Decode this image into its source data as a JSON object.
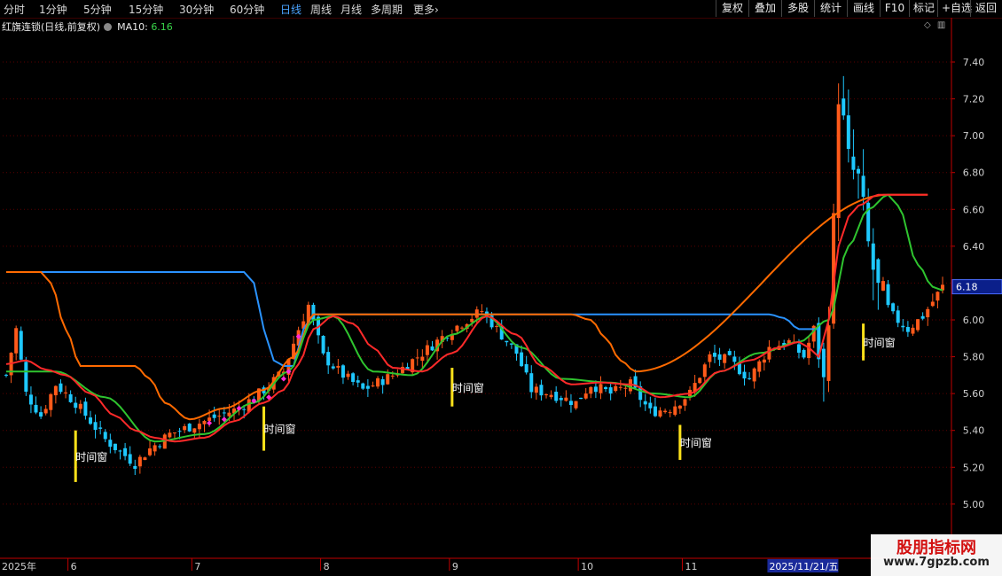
{
  "toolbar": {
    "periods": [
      "分时",
      "1分钟",
      "5分钟",
      "15分钟",
      "30分钟",
      "60分钟",
      "日线",
      "周线",
      "月线",
      "多周期",
      "更多"
    ],
    "active_period": "日线",
    "more_arrow": "›",
    "buttons": [
      "复权",
      "叠加",
      "多股",
      "统计",
      "画线",
      "F10",
      "标记",
      "+自选",
      "返回"
    ]
  },
  "info": {
    "title": "红旗连锁(日线,前复权)",
    "ma_label": "MA10:",
    "ma_value": "6.16"
  },
  "icons": [
    "diamond-icon",
    "panel-icon"
  ],
  "price_tag": "6.18",
  "signal_label": "时间窗",
  "watermark": {
    "line1": "股朋指标网",
    "line2": "www.7gpzb.com"
  },
  "colors": {
    "up": "#ff5a1a",
    "down": "#1ec8ff",
    "red_line": "#ff2a2a",
    "blue_line": "#2a93ff",
    "orange_line": "#ff6a00",
    "green_line": "#2fc42f",
    "signal": "#ffe21a",
    "dot": "#ff2ad6",
    "axis": "#c00000"
  },
  "chart_data": {
    "type": "candlestick",
    "title": "红旗连锁(日线,前复权)",
    "y_ticks": [
      5.0,
      5.2,
      5.4,
      5.6,
      5.8,
      6.0,
      6.2,
      6.4,
      6.6,
      6.8,
      7.0,
      7.2,
      7.4
    ],
    "ylim": [
      4.88,
      7.57
    ],
    "x_labels": [
      {
        "label": "2025年",
        "index": 0
      },
      {
        "label": "6",
        "index": 13
      },
      {
        "label": "7",
        "index": 38
      },
      {
        "label": "8",
        "index": 64
      },
      {
        "label": "9",
        "index": 90
      },
      {
        "label": "10",
        "index": 116
      },
      {
        "label": "11",
        "index": 137
      },
      {
        "label": "2025/11/21/五",
        "index": 154
      }
    ],
    "num_candles": 190,
    "anchors": [
      {
        "i": 0,
        "p": 5.7
      },
      {
        "i": 2,
        "p": 5.95
      },
      {
        "i": 4,
        "p": 5.6
      },
      {
        "i": 7,
        "p": 5.48
      },
      {
        "i": 10,
        "p": 5.65
      },
      {
        "i": 14,
        "p": 5.55
      },
      {
        "i": 20,
        "p": 5.35
      },
      {
        "i": 26,
        "p": 5.22
      },
      {
        "i": 29,
        "p": 5.3
      },
      {
        "i": 33,
        "p": 5.38
      },
      {
        "i": 40,
        "p": 5.45
      },
      {
        "i": 47,
        "p": 5.52
      },
      {
        "i": 52,
        "p": 5.62
      },
      {
        "i": 56,
        "p": 5.72
      },
      {
        "i": 59,
        "p": 5.95
      },
      {
        "i": 61,
        "p": 6.08
      },
      {
        "i": 64,
        "p": 5.8
      },
      {
        "i": 68,
        "p": 5.7
      },
      {
        "i": 72,
        "p": 5.62
      },
      {
        "i": 78,
        "p": 5.7
      },
      {
        "i": 84,
        "p": 5.82
      },
      {
        "i": 90,
        "p": 5.95
      },
      {
        "i": 96,
        "p": 6.05
      },
      {
        "i": 99,
        "p": 5.95
      },
      {
        "i": 103,
        "p": 5.82
      },
      {
        "i": 106,
        "p": 5.62
      },
      {
        "i": 110,
        "p": 5.6
      },
      {
        "i": 115,
        "p": 5.55
      },
      {
        "i": 118,
        "p": 5.65
      },
      {
        "i": 122,
        "p": 5.6
      },
      {
        "i": 126,
        "p": 5.65
      },
      {
        "i": 130,
        "p": 5.5
      },
      {
        "i": 134,
        "p": 5.52
      },
      {
        "i": 138,
        "p": 5.6
      },
      {
        "i": 142,
        "p": 5.8
      },
      {
        "i": 146,
        "p": 5.78
      },
      {
        "i": 150,
        "p": 5.68
      },
      {
        "i": 154,
        "p": 5.85
      },
      {
        "i": 158,
        "p": 5.88
      },
      {
        "i": 161,
        "p": 5.8
      },
      {
        "i": 163,
        "p": 5.95
      },
      {
        "i": 165,
        "p": 5.65
      },
      {
        "i": 167,
        "p": 6.5
      },
      {
        "i": 168,
        "p": 7.25
      },
      {
        "i": 170,
        "p": 6.85
      },
      {
        "i": 172,
        "p": 6.75
      },
      {
        "i": 174,
        "p": 6.4
      },
      {
        "i": 176,
        "p": 6.15
      },
      {
        "i": 179,
        "p": 6.02
      },
      {
        "i": 182,
        "p": 5.95
      },
      {
        "i": 185,
        "p": 6.02
      },
      {
        "i": 189,
        "p": 6.18
      }
    ],
    "series": [
      {
        "name": "MA10",
        "points": [
          {
            "i": 0,
            "v": 5.72
          },
          {
            "i": 10,
            "v": 5.72
          },
          {
            "i": 20,
            "v": 5.58
          },
          {
            "i": 30,
            "v": 5.34
          },
          {
            "i": 40,
            "v": 5.38
          },
          {
            "i": 50,
            "v": 5.55
          },
          {
            "i": 57,
            "v": 5.72
          },
          {
            "i": 62,
            "v": 6.0
          },
          {
            "i": 66,
            "v": 6.02
          },
          {
            "i": 74,
            "v": 5.72
          },
          {
            "i": 82,
            "v": 5.7
          },
          {
            "i": 90,
            "v": 5.92
          },
          {
            "i": 97,
            "v": 6.02
          },
          {
            "i": 104,
            "v": 5.85
          },
          {
            "i": 112,
            "v": 5.68
          },
          {
            "i": 122,
            "v": 5.66
          },
          {
            "i": 131,
            "v": 5.6
          },
          {
            "i": 138,
            "v": 5.58
          },
          {
            "i": 144,
            "v": 5.72
          },
          {
            "i": 152,
            "v": 5.82
          },
          {
            "i": 160,
            "v": 5.88
          },
          {
            "i": 166,
            "v": 6.0
          },
          {
            "i": 170,
            "v": 6.4
          },
          {
            "i": 174,
            "v": 6.6
          },
          {
            "i": 178,
            "v": 6.68
          },
          {
            "i": 180,
            "v": 6.62
          },
          {
            "i": 184,
            "v": 6.3
          },
          {
            "i": 187,
            "v": 6.18
          },
          {
            "i": 189,
            "v": 6.16
          }
        ]
      },
      {
        "name": "upper",
        "points": [
          {
            "i": 0,
            "v": 6.26
          },
          {
            "i": 48,
            "v": 6.26
          },
          {
            "i": 50,
            "v": 6.2
          },
          {
            "i": 52,
            "v": 5.95
          },
          {
            "i": 54,
            "v": 5.78
          },
          {
            "i": 56,
            "v": 5.75
          },
          {
            "i": 58,
            "v": 5.75
          },
          {
            "i": 60,
            "v": 5.95
          },
          {
            "i": 62,
            "v": 6.03
          },
          {
            "i": 154,
            "v": 6.03
          },
          {
            "i": 157,
            "v": 6.01
          },
          {
            "i": 160,
            "v": 5.95
          },
          {
            "i": 164,
            "v": 5.95
          }
        ]
      },
      {
        "name": "lower",
        "points": [
          {
            "i": 0,
            "v": 6.26
          },
          {
            "i": 7,
            "v": 6.26
          },
          {
            "i": 9,
            "v": 6.2
          },
          {
            "i": 12,
            "v": 5.95
          },
          {
            "i": 15,
            "v": 5.75
          },
          {
            "i": 20,
            "v": 5.75
          },
          {
            "i": 26,
            "v": 5.75
          },
          {
            "i": 29,
            "v": 5.68
          },
          {
            "i": 32,
            "v": 5.55
          },
          {
            "i": 37,
            "v": 5.46
          },
          {
            "i": 44,
            "v": 5.52
          },
          {
            "i": 52,
            "v": 5.62
          },
          {
            "i": 58,
            "v": 5.8
          },
          {
            "i": 62,
            "v": 6.03
          },
          {
            "i": 114,
            "v": 6.03
          },
          {
            "i": 118,
            "v": 6.0
          },
          {
            "i": 121,
            "v": 5.9
          },
          {
            "i": 124,
            "v": 5.78
          },
          {
            "i": 127,
            "v": 5.72
          },
          {
            "i": 178,
            "v": 6.68
          },
          {
            "i": 186,
            "v": 6.68
          }
        ]
      },
      {
        "name": "trend",
        "points": [
          {
            "i": 0,
            "v": 5.76
          },
          {
            "i": 4,
            "v": 5.78
          },
          {
            "i": 8,
            "v": 5.73
          },
          {
            "i": 12,
            "v": 5.7
          },
          {
            "i": 17,
            "v": 5.6
          },
          {
            "i": 22,
            "v": 5.48
          },
          {
            "i": 26,
            "v": 5.4
          },
          {
            "i": 30,
            "v": 5.36
          },
          {
            "i": 34,
            "v": 5.34
          },
          {
            "i": 40,
            "v": 5.36
          },
          {
            "i": 46,
            "v": 5.45
          },
          {
            "i": 52,
            "v": 5.55
          },
          {
            "i": 56,
            "v": 5.62
          },
          {
            "i": 59,
            "v": 5.76
          },
          {
            "i": 62,
            "v": 5.95
          },
          {
            "i": 66,
            "v": 6.02
          },
          {
            "i": 70,
            "v": 5.98
          },
          {
            "i": 74,
            "v": 5.85
          },
          {
            "i": 78,
            "v": 5.74
          },
          {
            "i": 84,
            "v": 5.72
          },
          {
            "i": 90,
            "v": 5.82
          },
          {
            "i": 97,
            "v": 6.02
          },
          {
            "i": 103,
            "v": 5.92
          },
          {
            "i": 108,
            "v": 5.75
          },
          {
            "i": 114,
            "v": 5.65
          },
          {
            "i": 120,
            "v": 5.66
          },
          {
            "i": 126,
            "v": 5.65
          },
          {
            "i": 132,
            "v": 5.58
          },
          {
            "i": 138,
            "v": 5.6
          },
          {
            "i": 144,
            "v": 5.72
          },
          {
            "i": 150,
            "v": 5.78
          },
          {
            "i": 156,
            "v": 5.85
          },
          {
            "i": 160,
            "v": 5.88
          },
          {
            "i": 162,
            "v": 5.85
          },
          {
            "i": 164,
            "v": 5.8
          },
          {
            "i": 166,
            "v": 6.0
          },
          {
            "i": 168,
            "v": 6.4
          },
          {
            "i": 170,
            "v": 6.56
          },
          {
            "i": 172,
            "v": 6.62
          },
          {
            "i": 176,
            "v": 6.68
          },
          {
            "i": 186,
            "v": 6.68
          }
        ]
      }
    ],
    "signals": [
      {
        "i": 14,
        "low": 5.12,
        "high": 5.4
      },
      {
        "i": 52,
        "low": 5.29,
        "high": 5.53
      },
      {
        "i": 90,
        "low": 5.53,
        "high": 5.74
      },
      {
        "i": 136,
        "low": 5.24,
        "high": 5.43
      },
      {
        "i": 173,
        "low": 5.78,
        "high": 5.98
      }
    ],
    "dots": [
      {
        "i": 41,
        "v": 5.44
      },
      {
        "i": 44,
        "v": 5.46
      },
      {
        "i": 47,
        "v": 5.52
      },
      {
        "i": 50,
        "v": 5.56
      },
      {
        "i": 53,
        "v": 5.58
      },
      {
        "i": 56,
        "v": 5.68
      },
      {
        "i": 57,
        "v": 5.72
      },
      {
        "i": 59,
        "v": 5.91
      }
    ]
  }
}
